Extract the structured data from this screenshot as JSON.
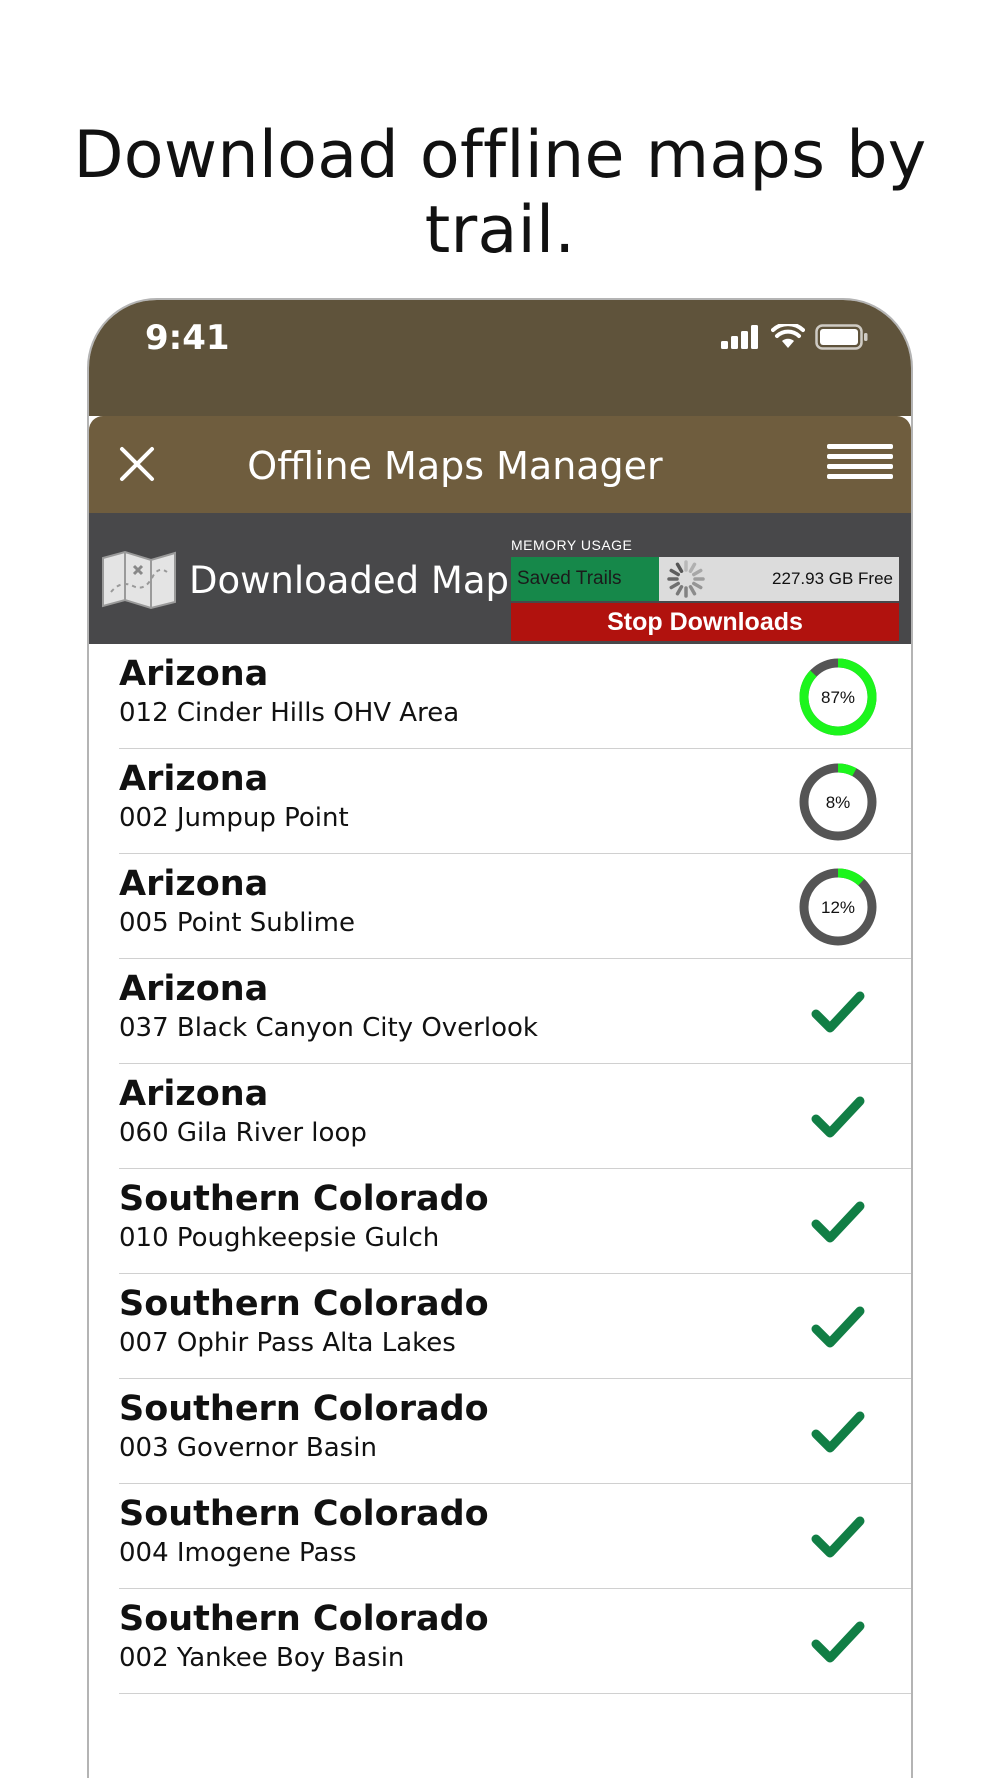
{
  "headline": "Download offline maps by trail.",
  "status_bar": {
    "time": "9:41"
  },
  "header": {
    "title": "Offline Maps Manager",
    "close_icon": "close-icon",
    "menu_icon": "hamburger-menu-icon"
  },
  "downloaded": {
    "title": "Downloaded Maps",
    "memory_label": "MEMORY USAGE",
    "saved_label": "Saved Trails",
    "free_label": "227.93 GB Free",
    "stop_label": "Stop Downloads"
  },
  "colors": {
    "status_bg": "#5f533b",
    "header_bg": "#6f5d3e",
    "bar_bg": "#48484a",
    "saved_green": "#16884a",
    "stop_red": "#b1120e",
    "progress_green": "#1cf51c",
    "progress_track": "#555555",
    "check_green": "#117e45"
  },
  "rows": [
    {
      "region": "Arizona",
      "trail": "012 Cinder Hills OHV Area",
      "status": "progress",
      "progress": 87,
      "progress_label": "87%"
    },
    {
      "region": "Arizona",
      "trail": "002 Jumpup Point",
      "status": "progress",
      "progress": 8,
      "progress_label": "8%"
    },
    {
      "region": "Arizona",
      "trail": "005 Point Sublime",
      "status": "progress",
      "progress": 12,
      "progress_label": "12%"
    },
    {
      "region": "Arizona",
      "trail": "037 Black Canyon City Overlook",
      "status": "done"
    },
    {
      "region": "Arizona",
      "trail": "060 Gila River loop",
      "status": "done"
    },
    {
      "region": "Southern Colorado",
      "trail": "010 Poughkeepsie Gulch",
      "status": "done"
    },
    {
      "region": "Southern Colorado",
      "trail": "007 Ophir Pass Alta Lakes",
      "status": "done"
    },
    {
      "region": "Southern Colorado",
      "trail": "003 Governor Basin",
      "status": "done"
    },
    {
      "region": "Southern Colorado",
      "trail": "004 Imogene Pass",
      "status": "done"
    },
    {
      "region": "Southern Colorado",
      "trail": "002 Yankee Boy Basin",
      "status": "done"
    }
  ]
}
